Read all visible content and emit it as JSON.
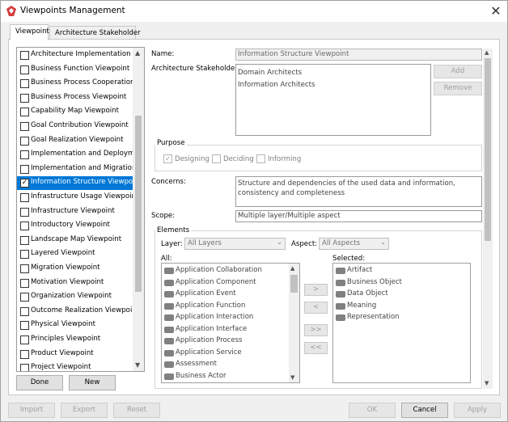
{
  "window": {
    "title": "Viewpoints Management"
  },
  "tabs": [
    {
      "label": "Viewpoint",
      "active": true
    },
    {
      "label": "Architecture Stakeholder",
      "active": false
    }
  ],
  "viewpoints": [
    {
      "label": "Architecture Implementation and Migration Viewpoint",
      "checked": false
    },
    {
      "label": "Business Function Viewpoint",
      "checked": false
    },
    {
      "label": "Business Process Cooperation Viewpoint",
      "checked": false
    },
    {
      "label": "Business Process Viewpoint",
      "checked": false
    },
    {
      "label": "Capability Map Viewpoint",
      "checked": false
    },
    {
      "label": "Goal Contribution Viewpoint",
      "checked": false
    },
    {
      "label": "Goal Realization Viewpoint",
      "checked": false
    },
    {
      "label": "Implementation and Deployment Viewpoint",
      "checked": false
    },
    {
      "label": "Implementation and Migration Viewpoint",
      "checked": false
    },
    {
      "label": "Information Structure Viewpoint",
      "checked": true,
      "selected": true
    },
    {
      "label": "Infrastructure Usage Viewpoint",
      "checked": false
    },
    {
      "label": "Infrastructure Viewpoint",
      "checked": false
    },
    {
      "label": "Introductory Viewpoint",
      "checked": false
    },
    {
      "label": "Landscape Map Viewpoint",
      "checked": false
    },
    {
      "label": "Layered Viewpoint",
      "checked": false
    },
    {
      "label": "Migration Viewpoint",
      "checked": false
    },
    {
      "label": "Motivation Viewpoint",
      "checked": false
    },
    {
      "label": "Organization Viewpoint",
      "checked": false
    },
    {
      "label": "Outcome Realization Viewpoint",
      "checked": false
    },
    {
      "label": "Physical Viewpoint",
      "checked": false
    },
    {
      "label": "Principles Viewpoint",
      "checked": false
    },
    {
      "label": "Product Viewpoint",
      "checked": false
    },
    {
      "label": "Project Viewpoint",
      "checked": false
    }
  ],
  "list_buttons": {
    "done": "Done",
    "new": "New"
  },
  "form": {
    "name_label": "Name:",
    "name_value": "Information Structure Viewpoint",
    "stakeholders_label": "Architecture Stakeholders:",
    "stakeholders": [
      "Domain Architects",
      "Information Architects"
    ],
    "add_label": "Add",
    "remove_label": "Remove",
    "purpose_label": "Purpose",
    "purpose_options": [
      {
        "label": "Designing",
        "checked": true
      },
      {
        "label": "Deciding",
        "checked": false
      },
      {
        "label": "Informing",
        "checked": false
      }
    ],
    "concerns_label": "Concerns:",
    "concerns_value": "Structure and dependencies of the used data and information, consistency and completeness",
    "scope_label": "Scope:",
    "scope_value": "Multiple layer/Multiple aspect",
    "elements_label": "Elements",
    "layer_label": "Layer:",
    "layer_value": "All Layers",
    "aspect_label": "Aspect:",
    "aspect_value": "All Aspects",
    "all_label": "All:",
    "selected_label": "Selected:",
    "all_elements": [
      {
        "label": "Application Collaboration",
        "icon": "application-collaboration-icon"
      },
      {
        "label": "Application Component",
        "icon": "application-component-icon"
      },
      {
        "label": "Application Event",
        "icon": "application-event-icon"
      },
      {
        "label": "Application Function",
        "icon": "application-function-icon"
      },
      {
        "label": "Application Interaction",
        "icon": "application-interaction-icon"
      },
      {
        "label": "Application Interface",
        "icon": "application-interface-icon"
      },
      {
        "label": "Application Process",
        "icon": "application-process-icon"
      },
      {
        "label": "Application Service",
        "icon": "application-service-icon"
      },
      {
        "label": "Assessment",
        "icon": "assessment-icon"
      },
      {
        "label": "Business Actor",
        "icon": "business-actor-icon"
      }
    ],
    "selected_elements": [
      {
        "label": "Artifact",
        "icon": "artifact-icon"
      },
      {
        "label": "Business Object",
        "icon": "business-object-icon"
      },
      {
        "label": "Data Object",
        "icon": "data-object-icon"
      },
      {
        "label": "Meaning",
        "icon": "meaning-icon"
      },
      {
        "label": "Representation",
        "icon": "representation-icon"
      }
    ],
    "move_buttons": {
      "add_one": ">",
      "remove_one": "<",
      "add_all": ">>",
      "remove_all": "<<"
    }
  },
  "bottom_buttons": {
    "import": "Import",
    "export": "Export",
    "reset": "Reset",
    "ok": "OK",
    "cancel": "Cancel",
    "apply": "Apply"
  },
  "colors": {
    "selection": "#0078d7",
    "app_icon": "#d23b3b"
  }
}
